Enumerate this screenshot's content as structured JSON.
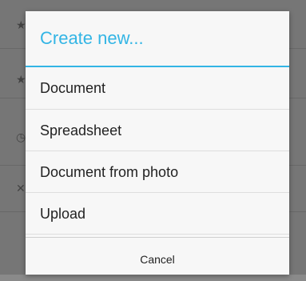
{
  "dialog": {
    "title": "Create new...",
    "accent_color": "#33b5e5",
    "items": [
      {
        "label": "Document"
      },
      {
        "label": "Spreadsheet"
      },
      {
        "label": "Document from photo"
      },
      {
        "label": "Upload"
      }
    ],
    "cancel_label": "Cancel"
  },
  "background": {
    "rows": [
      {
        "icon": "star-icon"
      },
      {
        "icon": "star-icon"
      },
      {
        "icon": "clock-icon"
      },
      {
        "icon": "pin-icon"
      }
    ]
  }
}
